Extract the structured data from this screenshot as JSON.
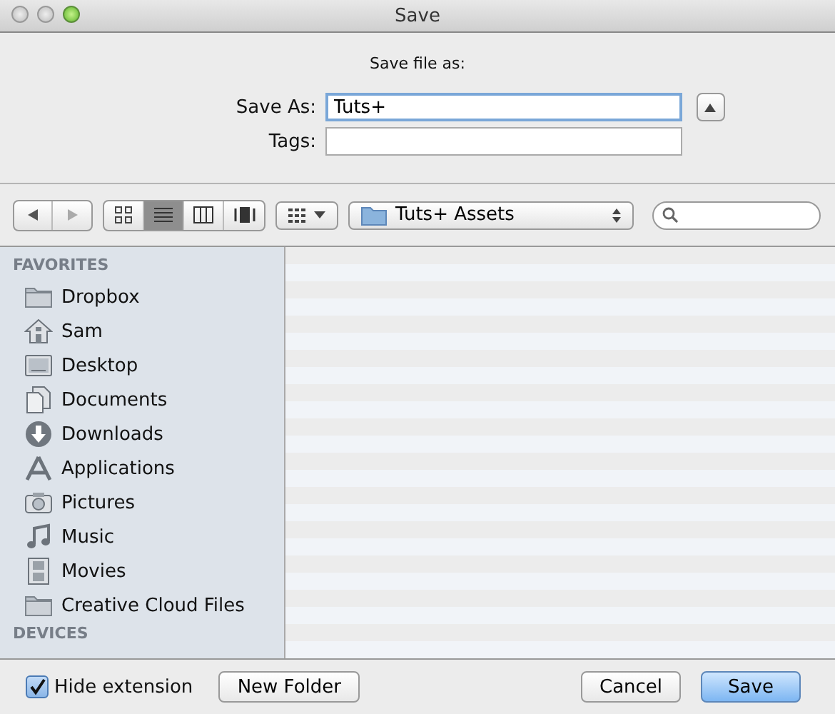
{
  "window": {
    "title": "Save"
  },
  "header": {
    "prompt": "Save file as:",
    "save_as": {
      "label": "Save As:",
      "value": "Tuts+",
      "focused": true
    },
    "tags": {
      "label": "Tags:"
    },
    "expanded": true
  },
  "toolbar": {
    "view_modes": [
      {
        "kind": "icons",
        "selected": false
      },
      {
        "kind": "list",
        "selected": true
      },
      {
        "kind": "columns",
        "selected": false
      },
      {
        "kind": "coverflow",
        "selected": false
      }
    ],
    "location": "Tuts+ Assets"
  },
  "sidebar": {
    "sections": [
      {
        "title": "FAVORITES",
        "items": [
          {
            "label": "Dropbox",
            "kind": "folder"
          },
          {
            "label": "Sam",
            "kind": "home"
          },
          {
            "label": "Desktop",
            "kind": "desktop"
          },
          {
            "label": "Documents",
            "kind": "documents"
          },
          {
            "label": "Downloads",
            "kind": "downloads"
          },
          {
            "label": "Applications",
            "kind": "applications"
          },
          {
            "label": "Pictures",
            "kind": "camera"
          },
          {
            "label": "Music",
            "kind": "music"
          },
          {
            "label": "Movies",
            "kind": "film"
          },
          {
            "label": "Creative Cloud Files",
            "kind": "folder"
          }
        ]
      },
      {
        "title": "DEVICES"
      }
    ]
  },
  "footer": {
    "hide_extension": {
      "label": "Hide extension",
      "checked": true
    },
    "new_folder": "New Folder",
    "cancel": "Cancel",
    "save": "Save"
  }
}
